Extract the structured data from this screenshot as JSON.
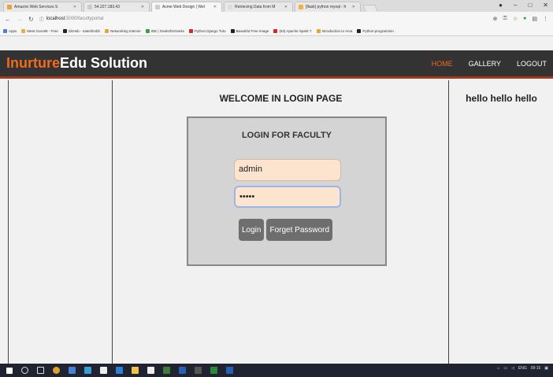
{
  "browser": {
    "tabs": [
      {
        "label": "Amazon Web Services S"
      },
      {
        "label": "54.227.183.43"
      },
      {
        "label": "Acme Web Design | Wel"
      },
      {
        "label": "Retrieving Data from M"
      },
      {
        "label": "[flask] python mysql - fr"
      }
    ],
    "url_host": "localhost",
    "url_path": ":5000/facultyportal",
    "bookmarks": [
      "Apps",
      "Meet Guru99 - Free",
      "GitHub - nateshmbh",
      "Networking Intervie",
      "IDE | GeeksforGeeks",
      "Python Django Tuto",
      "Beautiful Free Image",
      "(53) Apache Spark T",
      "Introduction to Ama",
      "Python-programmin"
    ]
  },
  "site": {
    "brand_accent": "Inurture",
    "brand_rest": "Edu Solution",
    "nav": [
      "HOME",
      "GALLERY",
      "LOGOUT"
    ]
  },
  "main": {
    "welcome": "WELCOME IN LOGIN PAGE",
    "login_title": "LOGIN FOR FACULTY",
    "username_value": "admin",
    "password_value": "•••••",
    "login_button": "Login",
    "forget_button": "Forget Password"
  },
  "right": {
    "text": "hello hello hello"
  },
  "taskbar": {
    "lang": "ENG",
    "time": "09:15"
  },
  "colors": {
    "accent": "#f26a1b",
    "header": "#333333",
    "field": "#fde4cf"
  }
}
